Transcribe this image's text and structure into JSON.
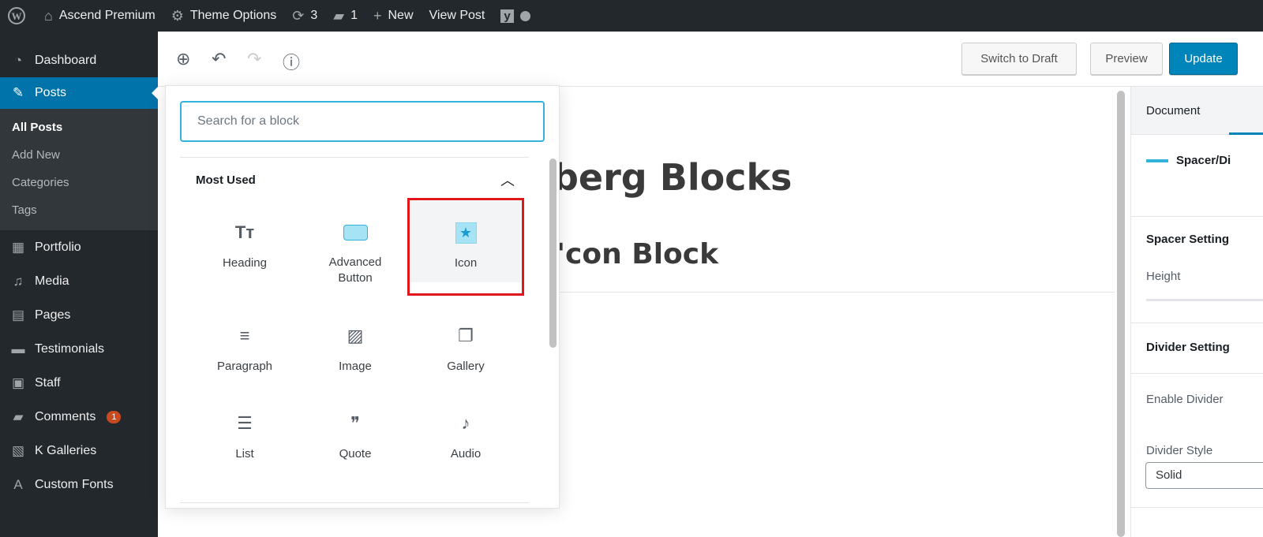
{
  "adminbar": {
    "site": "Ascend Premium",
    "theme_options": "Theme Options",
    "updates": "3",
    "comments": "1",
    "new": "New",
    "view_post": "View Post"
  },
  "sidebar": {
    "items": [
      {
        "label": "Dashboard",
        "icon": "◔"
      },
      {
        "label": "Posts",
        "icon": "📌"
      },
      {
        "label": "Portfolio",
        "icon": "▦"
      },
      {
        "label": "Media",
        "icon": "♫"
      },
      {
        "label": "Pages",
        "icon": "▤"
      },
      {
        "label": "Testimonials",
        "icon": "▬"
      },
      {
        "label": "Staff",
        "icon": "▣"
      },
      {
        "label": "Comments",
        "icon": "▰",
        "badge": "1"
      },
      {
        "label": "K Galleries",
        "icon": "▧"
      },
      {
        "label": "Custom Fonts",
        "icon": "A"
      }
    ],
    "submenu": [
      "All Posts",
      "Add New",
      "Categories",
      "Tags"
    ]
  },
  "toolbar": {
    "switch_draft": "Switch to Draft",
    "preview": "Preview",
    "update": "Update"
  },
  "editor": {
    "title_fragment": "berg Blocks",
    "subtitle_fragment": "'con Block"
  },
  "inserter": {
    "search_placeholder": "Search for a block",
    "section": "Most Used",
    "blocks": [
      {
        "label": "Heading",
        "icon": "Tт"
      },
      {
        "label": "Advanced Button",
        "icon": "button"
      },
      {
        "label": "Icon",
        "icon": "★"
      },
      {
        "label": "Paragraph",
        "icon": "≡"
      },
      {
        "label": "Image",
        "icon": "▨"
      },
      {
        "label": "Gallery",
        "icon": "❐"
      },
      {
        "label": "List",
        "icon": "☰"
      },
      {
        "label": "Quote",
        "icon": "❞"
      },
      {
        "label": "Audio",
        "icon": "♪"
      }
    ]
  },
  "settings": {
    "tab_document": "Document",
    "block_name": "Spacer/Di",
    "spacer_settings": "Spacer Setting",
    "height": "Height",
    "divider_settings": "Divider Setting",
    "enable_divider": "Enable Divider",
    "divider_style": "Divider Style",
    "divider_style_value": "Solid"
  },
  "colors": {
    "accent": "#0085ba",
    "highlight": "#e0161b"
  }
}
